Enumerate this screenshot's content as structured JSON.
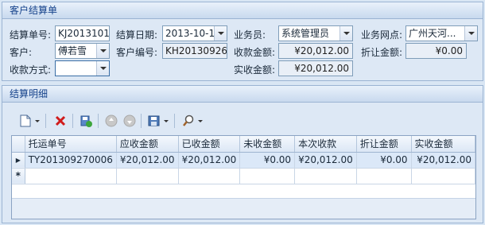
{
  "header": {
    "title": "客户结算单"
  },
  "form": {
    "settle_no_label": "结算单号:",
    "settle_no": "KJ2013101",
    "settle_date_label": "结算日期:",
    "settle_date": "2013-10-1",
    "staff_label": "业务员:",
    "staff": "系统管理员",
    "branch_label": "业务网点:",
    "branch": "广州天河...",
    "customer_label": "客户:",
    "customer": "傅若雪",
    "customer_no_label": "客户编号:",
    "customer_no": "KH20130926(",
    "received_label": "收款金额:",
    "received": "¥20,012.00",
    "discount_label": "折让金额:",
    "discount": "¥0.00",
    "pay_method_label": "收款方式:",
    "pay_method": "",
    "actual_label": "实收金额:",
    "actual": "¥20,012.00"
  },
  "detail": {
    "title": "结算明细"
  },
  "table": {
    "columns": [
      "托运单号",
      "应收金额",
      "已收金额",
      "未收金额",
      "本次收款",
      "折让金额",
      "实收金额"
    ],
    "rows": [
      [
        "TY201309270006",
        "¥20,012.00",
        "¥20,012.00",
        "¥0.00",
        "¥20,012.00",
        "¥0.00",
        "¥20,012.00"
      ]
    ],
    "new_row_marker": "*"
  },
  "icons": {
    "current_row": "▶"
  }
}
